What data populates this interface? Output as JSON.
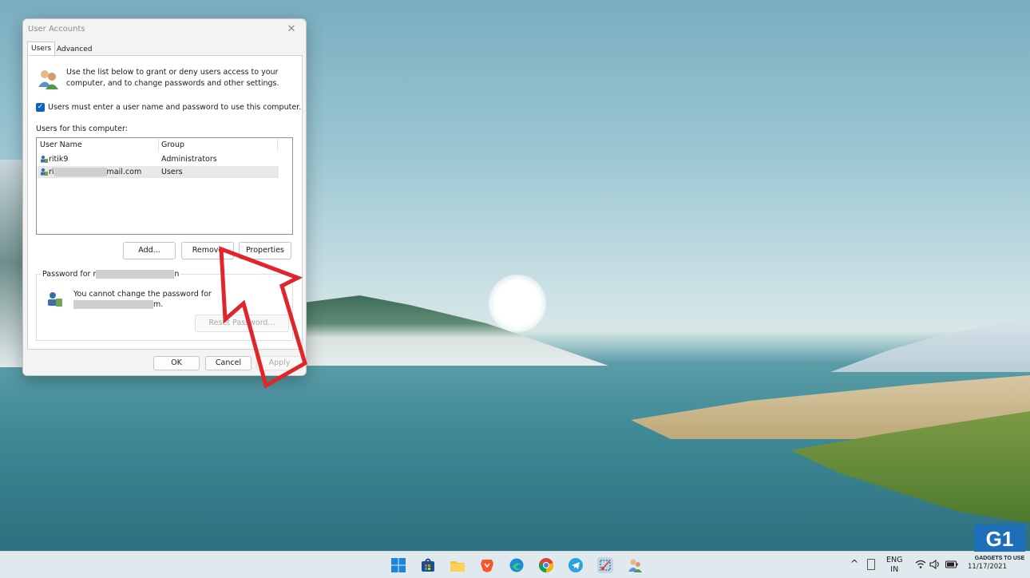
{
  "dialog": {
    "title": "User Accounts",
    "close_glyph": "✕",
    "tabs": [
      {
        "label": "Users",
        "active": true
      },
      {
        "label": "Advanced",
        "active": false
      }
    ],
    "intro_text": "Use the list below to grant or deny users access to your computer, and to change passwords and other settings.",
    "checkbox": {
      "label": "Users must enter a user name and password to use this computer.",
      "checked": true
    },
    "users_label": "Users for this computer:",
    "list": {
      "columns": [
        "User Name",
        "Group"
      ],
      "rows": [
        {
          "name_prefix": "ritik9",
          "name_suffix": "",
          "group": "Administrators",
          "selected": false
        },
        {
          "name_prefix": "ri",
          "name_suffix": "mail.com",
          "group": "Users",
          "selected": true
        }
      ]
    },
    "buttons": {
      "add": "Add...",
      "remove": "Remove",
      "properties": "Properties"
    },
    "password_group": {
      "label_prefix": "Password for r",
      "label_suffix": "n",
      "text_line1": "You cannot change the password for",
      "text_line2_suffix": "m.",
      "reset_button": "Reset Password..."
    },
    "footer": {
      "ok": "OK",
      "cancel": "Cancel",
      "apply": "Apply"
    }
  },
  "taskbar": {
    "icons": [
      "windows-start-icon",
      "store-icon",
      "file-explorer-icon",
      "brave-browser-icon",
      "edge-icon",
      "chrome-icon",
      "telegram-icon",
      "snipping-tool-icon",
      "user-accounts-icon"
    ],
    "tray": {
      "chevron": "^",
      "language_line1": "ENG",
      "language_line2": "IN",
      "date": "11/17/2021"
    }
  },
  "watermark_text": "GADGETS TO USE",
  "colors": {
    "accent": "#0b64c0",
    "annotation_arrow": "#e0262b"
  }
}
